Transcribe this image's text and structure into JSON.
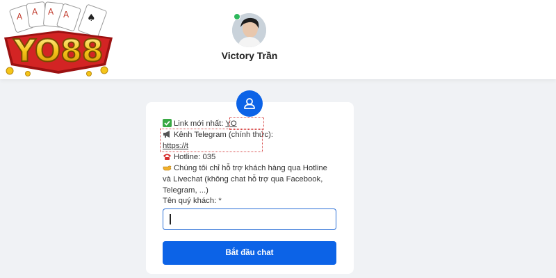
{
  "header": {
    "logo_text": "YO88",
    "agent_name": "Victory Trần",
    "agent_status": "online"
  },
  "chat_form": {
    "notice": {
      "link_label": "Link mới nhất: ",
      "link_value": "YO",
      "telegram_label": "Kênh Telegram (chính thức):",
      "telegram_value": "https://t",
      "hotline_label": "Hotline: ",
      "hotline_value": "035",
      "support_text": "Chúng tôi chỉ hỗ trợ khách hàng qua Hotline và Livechat (không chat hỗ trợ qua Facebook, Telegram, ...)"
    },
    "name_label": "Tên quý khách: *",
    "name_value": "",
    "submit_label": "Bắt đầu chat"
  },
  "icons": {
    "check": "check-mark-icon",
    "megaphone": "megaphone-icon",
    "phone": "telephone-icon",
    "pointing": "pointing-hand-icon",
    "user": "user-icon"
  },
  "colors": {
    "primary": "#0c63e7",
    "background": "#f0f2f5",
    "online": "#2eb85c"
  }
}
